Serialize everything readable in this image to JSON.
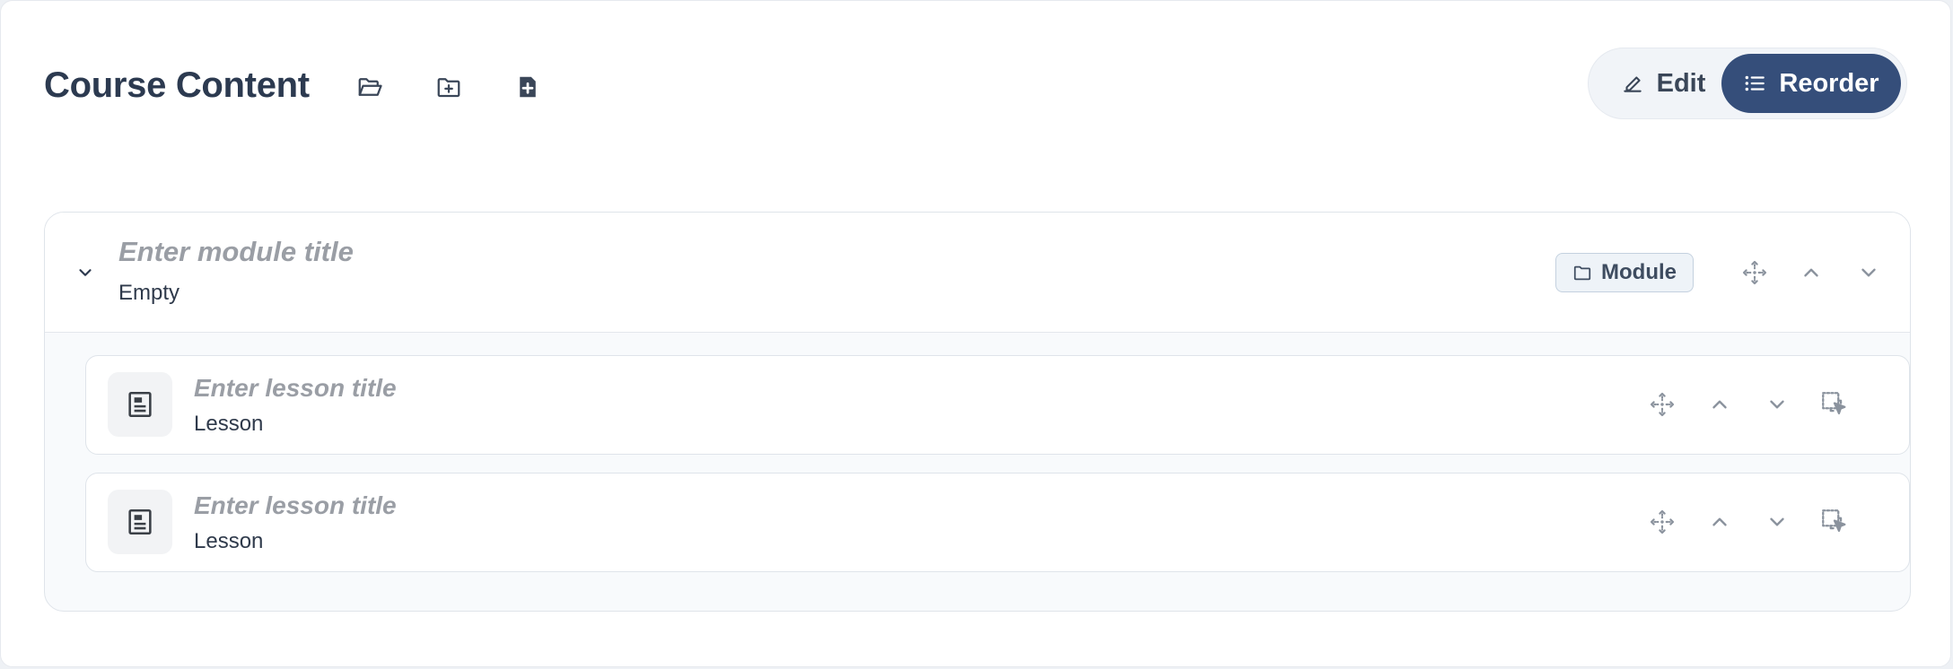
{
  "header": {
    "title": "Course Content",
    "icons": [
      "folder-open-icon",
      "folder-plus-icon",
      "file-plus-icon"
    ]
  },
  "mode_toggle": {
    "edit_label": "Edit",
    "reorder_label": "Reorder",
    "active": "Reorder",
    "active_color": "#354e7a"
  },
  "module": {
    "title_placeholder": "Enter module title",
    "status": "Empty",
    "badge": "Module",
    "lessons": [
      {
        "title_placeholder": "Enter lesson title",
        "type": "Lesson"
      },
      {
        "title_placeholder": "Enter lesson title",
        "type": "Lesson"
      }
    ]
  }
}
